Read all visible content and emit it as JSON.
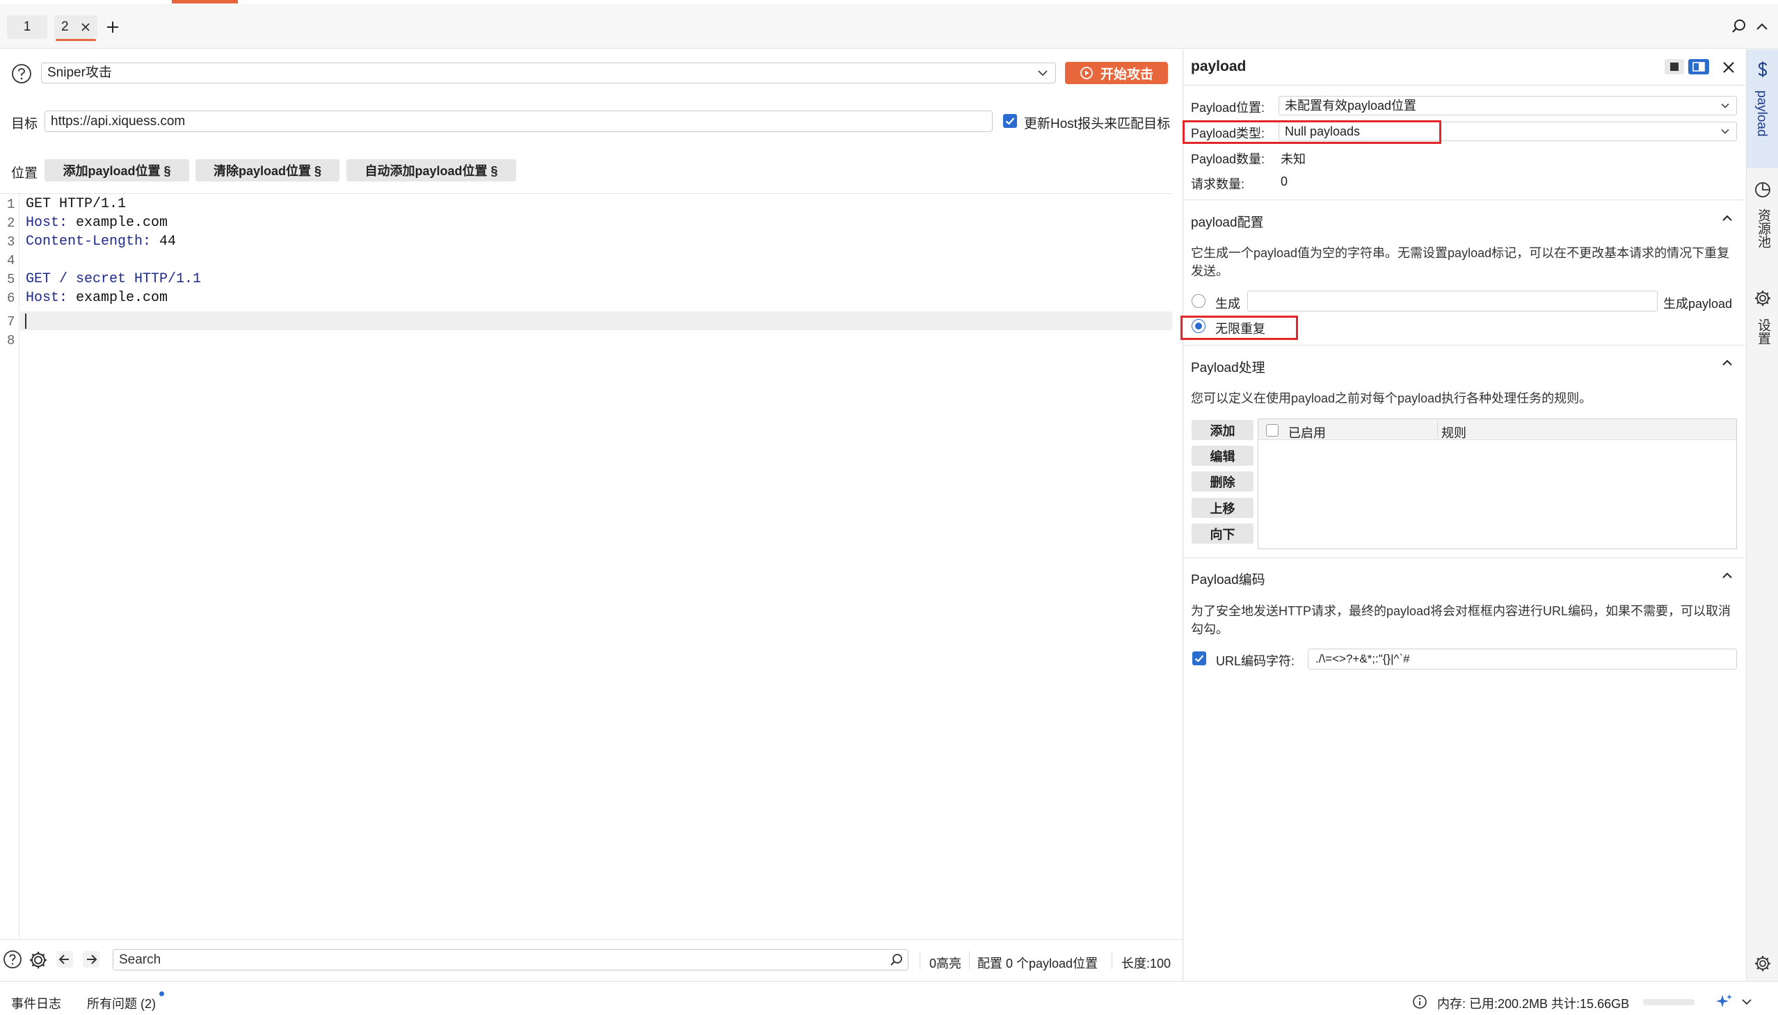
{
  "tabs": [
    {
      "label": "1"
    },
    {
      "label": "2"
    }
  ],
  "toolbar": {
    "attack_type": "Sniper攻击",
    "start_attack": "开始攻击",
    "target_label": "目标",
    "target_value": "https://api.xiquess.com",
    "update_host_label": "更新Host报头来匹配目标",
    "position_label": "位置",
    "add_payload_pos": "添加payload位置 §",
    "clear_payload_pos": "清除payload位置 §",
    "auto_payload_pos": "自动添加payload位置 §"
  },
  "editor": {
    "line_numbers": [
      "1",
      "2",
      "3",
      "4",
      "5",
      "6",
      "7",
      "8"
    ],
    "lines": [
      {
        "key": "GET HTTP/1.1",
        "rest": ""
      },
      {
        "key": "Host:",
        "rest": " example.com"
      },
      {
        "key": "Content-Length:",
        "rest": " 44"
      },
      {
        "key": "",
        "rest": ""
      },
      {
        "key": "GET / secret HTTP/1.1",
        "rest": ""
      },
      {
        "key": "Host:",
        "rest": " example.com"
      },
      {
        "key": "",
        "rest": ""
      },
      {
        "key": "",
        "rest": ""
      }
    ]
  },
  "bottom_bar": {
    "search_placeholder": "Search",
    "highlight_count": "0高亮",
    "payload_positions": "配置 0 个payload位置",
    "length": "长度:100"
  },
  "status_bar": {
    "event_log": "事件日志",
    "all_issues": "所有问题 (2)",
    "memory": "内存: 已用:200.2MB 共计:15.66GB"
  },
  "right_panel": {
    "title": "payload",
    "payload_position_label": "Payload位置:",
    "payload_position_value": "未配置有效payload位置",
    "payload_type_label": "Payload类型:",
    "payload_type_value": "Null payloads",
    "payload_count_label": "Payload数量:",
    "payload_count_value": "未知",
    "request_count_label": "请求数量:",
    "request_count_value": "0",
    "config_title": "payload配置",
    "config_desc": "它生成一个payload值为空的字符串。无需设置payload标记，可以在不更改基本请求的情况下重复发送。",
    "generate_label": "生成",
    "generate_suffix": "生成payload",
    "infinite_label": "无限重复",
    "processing_title": "Payload处理",
    "processing_desc": "您可以定义在使用payload之前对每个payload执行各种处理任务的规则。",
    "proc_buttons": [
      "添加",
      "编辑",
      "删除",
      "上移",
      "向下"
    ],
    "rules_col_enabled": "已启用",
    "rules_col_rule": "规则",
    "encoding_title": "Payload编码",
    "encoding_desc": "为了安全地发送HTTP请求，最终的payload将会对框框内容进行URL编码，如果不需要，可以取消勾勾。",
    "url_encode_label": "URL编码字符:",
    "url_encode_chars": "./\\=<>?+&*;:\"{}|^`#"
  },
  "side_rail": {
    "payload": "payload",
    "resource_pool": "资源池",
    "settings": "设置"
  },
  "colors": {
    "accent": "#e8663c",
    "primary": "#2b6cd1",
    "highlight_box": "#e3262a"
  }
}
